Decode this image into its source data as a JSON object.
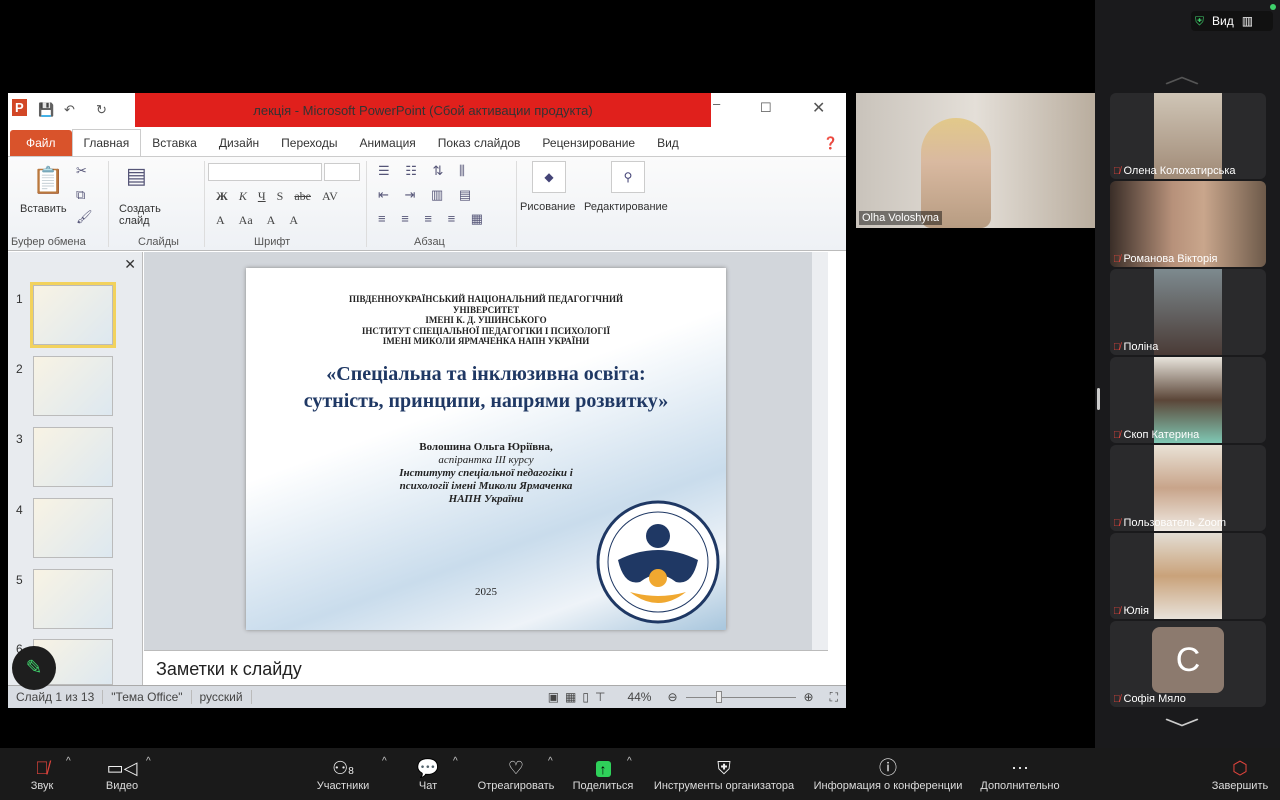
{
  "ppt": {
    "title": "лекція - Microsoft PowerPoint (Сбой активации продукта)",
    "tabs": [
      "Файл",
      "Главная",
      "Вставка",
      "Дизайн",
      "Переходы",
      "Анимация",
      "Показ слайдов",
      "Рецензирование",
      "Вид"
    ],
    "ribbon": {
      "paste": "Вставить",
      "new_slide": "Создать слайд",
      "drawing": "Рисование",
      "editing": "Редактирование",
      "groups": [
        "Буфер обмена",
        "Слайды",
        "Шрифт",
        "Абзац"
      ],
      "font_buttons": [
        "Ж",
        "К",
        "Ч",
        "S",
        "abe",
        "AV",
        "A",
        "Aa",
        "A",
        "A"
      ]
    },
    "thumb_numbers": [
      "1",
      "2",
      "3",
      "4",
      "5",
      "6"
    ],
    "slide": {
      "header": [
        "ПІВДЕННОУКРАЇНСЬКИЙ НАЦІОНАЛЬНИЙ ПЕДАГОГІЧНИЙ УНІВЕРСИТЕТ",
        "ІМЕНІ К. Д. УШИНСЬКОГО",
        "ІНСТИТУТ СПЕЦІАЛЬНОЇ ПЕДАГОГІКИ І ПСИХОЛОГІЇ",
        "ІМЕНІ МИКОЛИ ЯРМАЧЕНКА НАПН УКРАЇНИ"
      ],
      "title_1": "«Спеціальна та інклюзивна освіта:",
      "title_2": "сутність, принципи, напрями розвитку»",
      "author": "Волошина Ольга Юріївна,",
      "author_lines": [
        "аспірантка ІІІ курсу",
        "Інституту спеціальної педагогіки і",
        "психології імені Миколи Ярмаченка",
        "НАПН України"
      ],
      "year": "2025"
    },
    "notes": "Заметки к слайду",
    "status": {
      "slide": "Слайд 1 из 13",
      "theme": "\"Тема Office\"",
      "lang": "русский",
      "zoom": "44%"
    }
  },
  "speaker": {
    "name": "Olha Voloshyna"
  },
  "top": {
    "view": "Вид",
    "shield_color": "#3fd06b"
  },
  "participants": [
    {
      "name": "Олена Колохатирська"
    },
    {
      "name": "Романова Вікторія"
    },
    {
      "name": "Поліна"
    },
    {
      "name": "Скоп Катерина"
    },
    {
      "name": "Пользователь Zoom"
    },
    {
      "name": "Юлія"
    },
    {
      "name": "Софія Мяло",
      "initial": "C"
    }
  ],
  "toolbar": {
    "audio": "Звук",
    "video": "Видео",
    "participants": "Участники",
    "participants_count": "8",
    "chat": "Чат",
    "react": "Отреагировать",
    "share": "Поделиться",
    "host_tools": "Инструменты организатора",
    "info": "Информация о конференции",
    "more": "Дополнительно",
    "end": "Завершить",
    "share_color": "#2fd15a",
    "end_color": "#e0443c"
  }
}
